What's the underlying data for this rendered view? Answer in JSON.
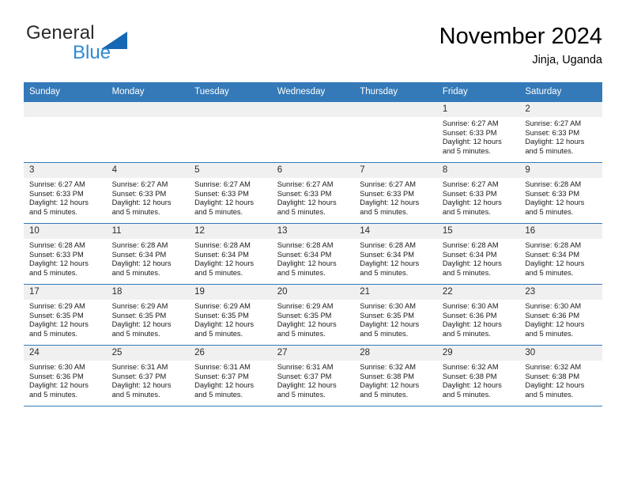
{
  "logo": {
    "word_top": "General",
    "word_bottom": "Blue",
    "triangle_color": "#1668b3",
    "text_color": "#2b2b2b",
    "blue_color": "#2e8ad4"
  },
  "header": {
    "month_title": "November 2024",
    "location": "Jinja, Uganda",
    "accent_color": "#3479b8"
  },
  "weekdays": [
    "Sunday",
    "Monday",
    "Tuesday",
    "Wednesday",
    "Thursday",
    "Friday",
    "Saturday"
  ],
  "weeks": [
    [
      {
        "day": "",
        "lines": []
      },
      {
        "day": "",
        "lines": []
      },
      {
        "day": "",
        "lines": []
      },
      {
        "day": "",
        "lines": []
      },
      {
        "day": "",
        "lines": []
      },
      {
        "day": "1",
        "lines": [
          "Sunrise: 6:27 AM",
          "Sunset: 6:33 PM",
          "Daylight: 12 hours",
          "and 5 minutes."
        ]
      },
      {
        "day": "2",
        "lines": [
          "Sunrise: 6:27 AM",
          "Sunset: 6:33 PM",
          "Daylight: 12 hours",
          "and 5 minutes."
        ]
      }
    ],
    [
      {
        "day": "3",
        "lines": [
          "Sunrise: 6:27 AM",
          "Sunset: 6:33 PM",
          "Daylight: 12 hours",
          "and 5 minutes."
        ]
      },
      {
        "day": "4",
        "lines": [
          "Sunrise: 6:27 AM",
          "Sunset: 6:33 PM",
          "Daylight: 12 hours",
          "and 5 minutes."
        ]
      },
      {
        "day": "5",
        "lines": [
          "Sunrise: 6:27 AM",
          "Sunset: 6:33 PM",
          "Daylight: 12 hours",
          "and 5 minutes."
        ]
      },
      {
        "day": "6",
        "lines": [
          "Sunrise: 6:27 AM",
          "Sunset: 6:33 PM",
          "Daylight: 12 hours",
          "and 5 minutes."
        ]
      },
      {
        "day": "7",
        "lines": [
          "Sunrise: 6:27 AM",
          "Sunset: 6:33 PM",
          "Daylight: 12 hours",
          "and 5 minutes."
        ]
      },
      {
        "day": "8",
        "lines": [
          "Sunrise: 6:27 AM",
          "Sunset: 6:33 PM",
          "Daylight: 12 hours",
          "and 5 minutes."
        ]
      },
      {
        "day": "9",
        "lines": [
          "Sunrise: 6:28 AM",
          "Sunset: 6:33 PM",
          "Daylight: 12 hours",
          "and 5 minutes."
        ]
      }
    ],
    [
      {
        "day": "10",
        "lines": [
          "Sunrise: 6:28 AM",
          "Sunset: 6:33 PM",
          "Daylight: 12 hours",
          "and 5 minutes."
        ]
      },
      {
        "day": "11",
        "lines": [
          "Sunrise: 6:28 AM",
          "Sunset: 6:34 PM",
          "Daylight: 12 hours",
          "and 5 minutes."
        ]
      },
      {
        "day": "12",
        "lines": [
          "Sunrise: 6:28 AM",
          "Sunset: 6:34 PM",
          "Daylight: 12 hours",
          "and 5 minutes."
        ]
      },
      {
        "day": "13",
        "lines": [
          "Sunrise: 6:28 AM",
          "Sunset: 6:34 PM",
          "Daylight: 12 hours",
          "and 5 minutes."
        ]
      },
      {
        "day": "14",
        "lines": [
          "Sunrise: 6:28 AM",
          "Sunset: 6:34 PM",
          "Daylight: 12 hours",
          "and 5 minutes."
        ]
      },
      {
        "day": "15",
        "lines": [
          "Sunrise: 6:28 AM",
          "Sunset: 6:34 PM",
          "Daylight: 12 hours",
          "and 5 minutes."
        ]
      },
      {
        "day": "16",
        "lines": [
          "Sunrise: 6:28 AM",
          "Sunset: 6:34 PM",
          "Daylight: 12 hours",
          "and 5 minutes."
        ]
      }
    ],
    [
      {
        "day": "17",
        "lines": [
          "Sunrise: 6:29 AM",
          "Sunset: 6:35 PM",
          "Daylight: 12 hours",
          "and 5 minutes."
        ]
      },
      {
        "day": "18",
        "lines": [
          "Sunrise: 6:29 AM",
          "Sunset: 6:35 PM",
          "Daylight: 12 hours",
          "and 5 minutes."
        ]
      },
      {
        "day": "19",
        "lines": [
          "Sunrise: 6:29 AM",
          "Sunset: 6:35 PM",
          "Daylight: 12 hours",
          "and 5 minutes."
        ]
      },
      {
        "day": "20",
        "lines": [
          "Sunrise: 6:29 AM",
          "Sunset: 6:35 PM",
          "Daylight: 12 hours",
          "and 5 minutes."
        ]
      },
      {
        "day": "21",
        "lines": [
          "Sunrise: 6:30 AM",
          "Sunset: 6:35 PM",
          "Daylight: 12 hours",
          "and 5 minutes."
        ]
      },
      {
        "day": "22",
        "lines": [
          "Sunrise: 6:30 AM",
          "Sunset: 6:36 PM",
          "Daylight: 12 hours",
          "and 5 minutes."
        ]
      },
      {
        "day": "23",
        "lines": [
          "Sunrise: 6:30 AM",
          "Sunset: 6:36 PM",
          "Daylight: 12 hours",
          "and 5 minutes."
        ]
      }
    ],
    [
      {
        "day": "24",
        "lines": [
          "Sunrise: 6:30 AM",
          "Sunset: 6:36 PM",
          "Daylight: 12 hours",
          "and 5 minutes."
        ]
      },
      {
        "day": "25",
        "lines": [
          "Sunrise: 6:31 AM",
          "Sunset: 6:37 PM",
          "Daylight: 12 hours",
          "and 5 minutes."
        ]
      },
      {
        "day": "26",
        "lines": [
          "Sunrise: 6:31 AM",
          "Sunset: 6:37 PM",
          "Daylight: 12 hours",
          "and 5 minutes."
        ]
      },
      {
        "day": "27",
        "lines": [
          "Sunrise: 6:31 AM",
          "Sunset: 6:37 PM",
          "Daylight: 12 hours",
          "and 5 minutes."
        ]
      },
      {
        "day": "28",
        "lines": [
          "Sunrise: 6:32 AM",
          "Sunset: 6:38 PM",
          "Daylight: 12 hours",
          "and 5 minutes."
        ]
      },
      {
        "day": "29",
        "lines": [
          "Sunrise: 6:32 AM",
          "Sunset: 6:38 PM",
          "Daylight: 12 hours",
          "and 5 minutes."
        ]
      },
      {
        "day": "30",
        "lines": [
          "Sunrise: 6:32 AM",
          "Sunset: 6:38 PM",
          "Daylight: 12 hours",
          "and 5 minutes."
        ]
      }
    ]
  ]
}
